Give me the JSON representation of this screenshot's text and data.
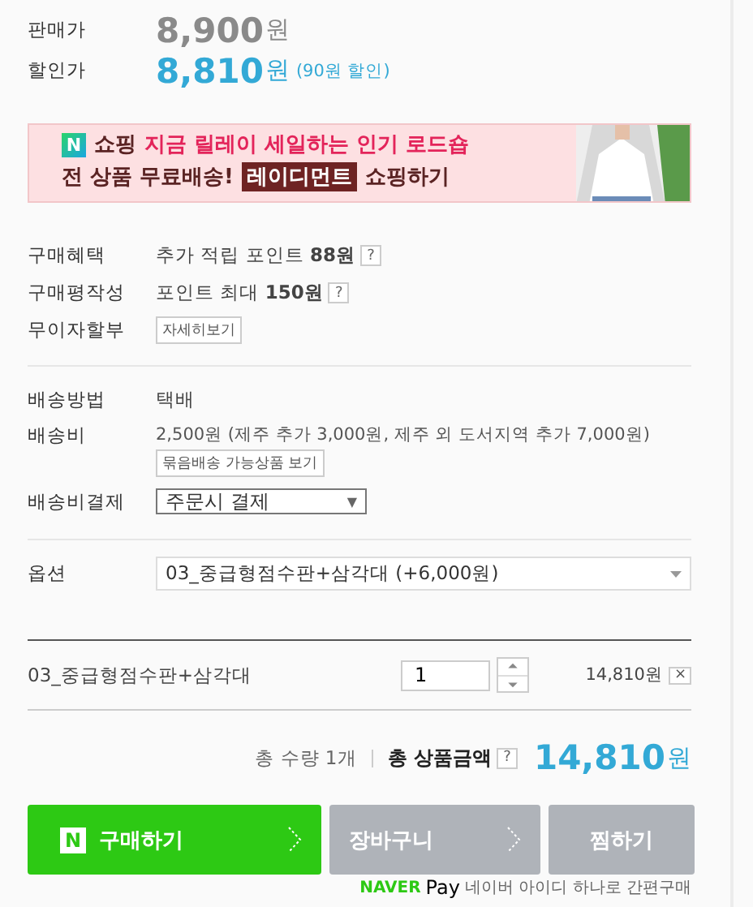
{
  "prices": [
    {
      "label": "판매가",
      "amount": "8,900",
      "unit": "원",
      "kind": "regular"
    },
    {
      "label": "할인가",
      "amount": "8,810",
      "unit": "원",
      "note": "(90원 할인)",
      "kind": "sale"
    }
  ],
  "banner": {
    "badge": "N",
    "line1": [
      {
        "text": "쇼핑",
        "kind": "plain"
      },
      {
        "text": "지금 릴레이 세일하는 인기 로드숍",
        "kind": "accent"
      }
    ],
    "line2": [
      {
        "text": "전 상품 무료배송!",
        "kind": "plain"
      },
      {
        "text": "레이디먼트",
        "kind": "highlight"
      },
      {
        "text": "쇼핑하기",
        "kind": "plain"
      }
    ]
  },
  "benefits": [
    {
      "label": "구매혜택",
      "text": "추가 적립 포인트 **88원**",
      "help": "?",
      "kind": "text"
    },
    {
      "label": "구매평작성",
      "text": "포인트 최대 **150원**",
      "help": "?",
      "kind": "text"
    },
    {
      "label": "무이자할부",
      "button": "자세히보기",
      "kind": "button"
    }
  ],
  "shipping": {
    "method_label": "배송방법",
    "method": "택배",
    "fee_label": "배송비",
    "fee": "2,500원 (제주 추가 3,000원, 제주 외 도서지역 추가 7,000원)",
    "bundle_button": "묶음배송 가능상품 보기",
    "payment_label": "배송비결제",
    "payment": {
      "value": "주문시 결제",
      "arrow": "▼"
    }
  },
  "option": {
    "label": "옵션",
    "value": "03_중급형점수판+삼각대 (+6,000원)"
  },
  "selected_item": {
    "name": "03_중급형점수판+삼각대",
    "quantity": "1",
    "price": "14,810원",
    "remove": "×"
  },
  "total": {
    "count": "총 수량 1개",
    "label": "총 상품금액",
    "help": "?",
    "amount": "14,810",
    "unit": "원"
  },
  "buttons": [
    {
      "label": "구매하기",
      "kind": "naver",
      "badge": "N"
    },
    {
      "label": "장바구니",
      "kind": "arrow"
    },
    {
      "label": "찜하기",
      "kind": "plain"
    }
  ],
  "footer": {
    "brand": "NAVER",
    "pay": "Pay",
    "text": "네이버 아이디 하나로 간편구매"
  }
}
